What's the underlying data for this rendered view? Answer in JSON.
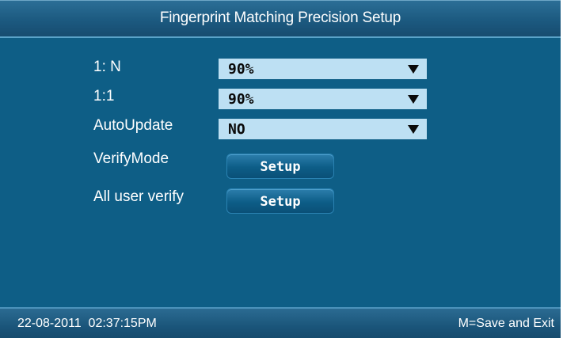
{
  "title": "Fingerprint Matching Precision Setup",
  "settings": {
    "one_to_n": {
      "label": "1: N",
      "value": "90%"
    },
    "one_to_one": {
      "label": "1:1",
      "value": "90%"
    },
    "auto_update": {
      "label": "AutoUpdate",
      "value": "NO"
    },
    "verify_mode": {
      "label": "VerifyMode",
      "button": "Setup"
    },
    "all_user_verify": {
      "label": "All user verify",
      "button": "Setup"
    }
  },
  "status": {
    "datetime": "22-08-2011  02:37:15PM",
    "hint": "M=Save and Exit"
  },
  "colors": {
    "background": "#0f5f86",
    "field": "#bde0f3",
    "text": "#ffffff"
  },
  "icons": [
    "dropdown-arrow-icon"
  ]
}
